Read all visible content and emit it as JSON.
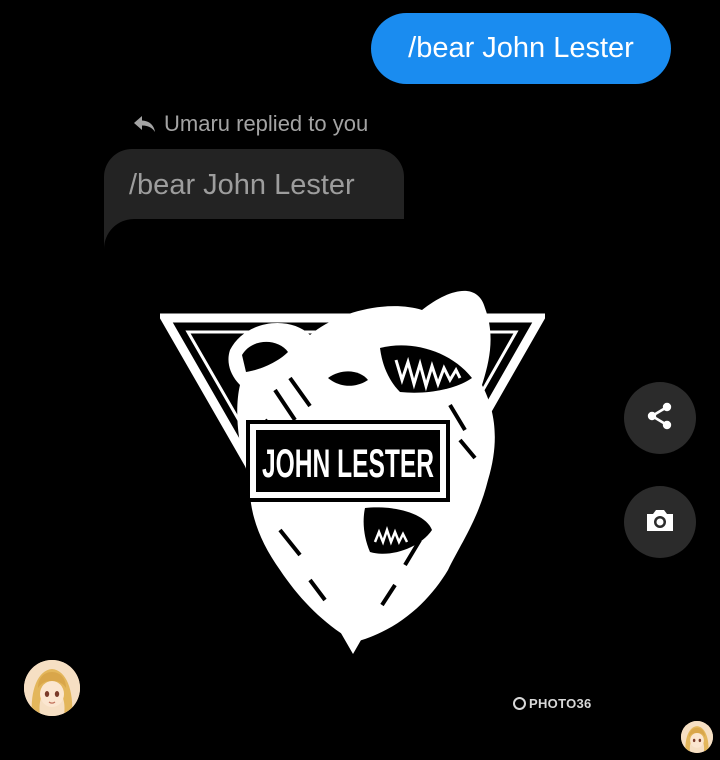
{
  "sent_message": {
    "text": "/bear John Lester"
  },
  "reply": {
    "header": "Umaru replied to you",
    "quoted_text": "/bear John Lester"
  },
  "image": {
    "banner_text": "JOHN LESTER",
    "watermark": "PHOTO36"
  },
  "actions": {
    "share_icon": "share-icon",
    "camera_icon": "camera-icon"
  },
  "colors": {
    "accent": "#1a8cf0",
    "bubble_dark": "#232323",
    "background": "#000000"
  }
}
